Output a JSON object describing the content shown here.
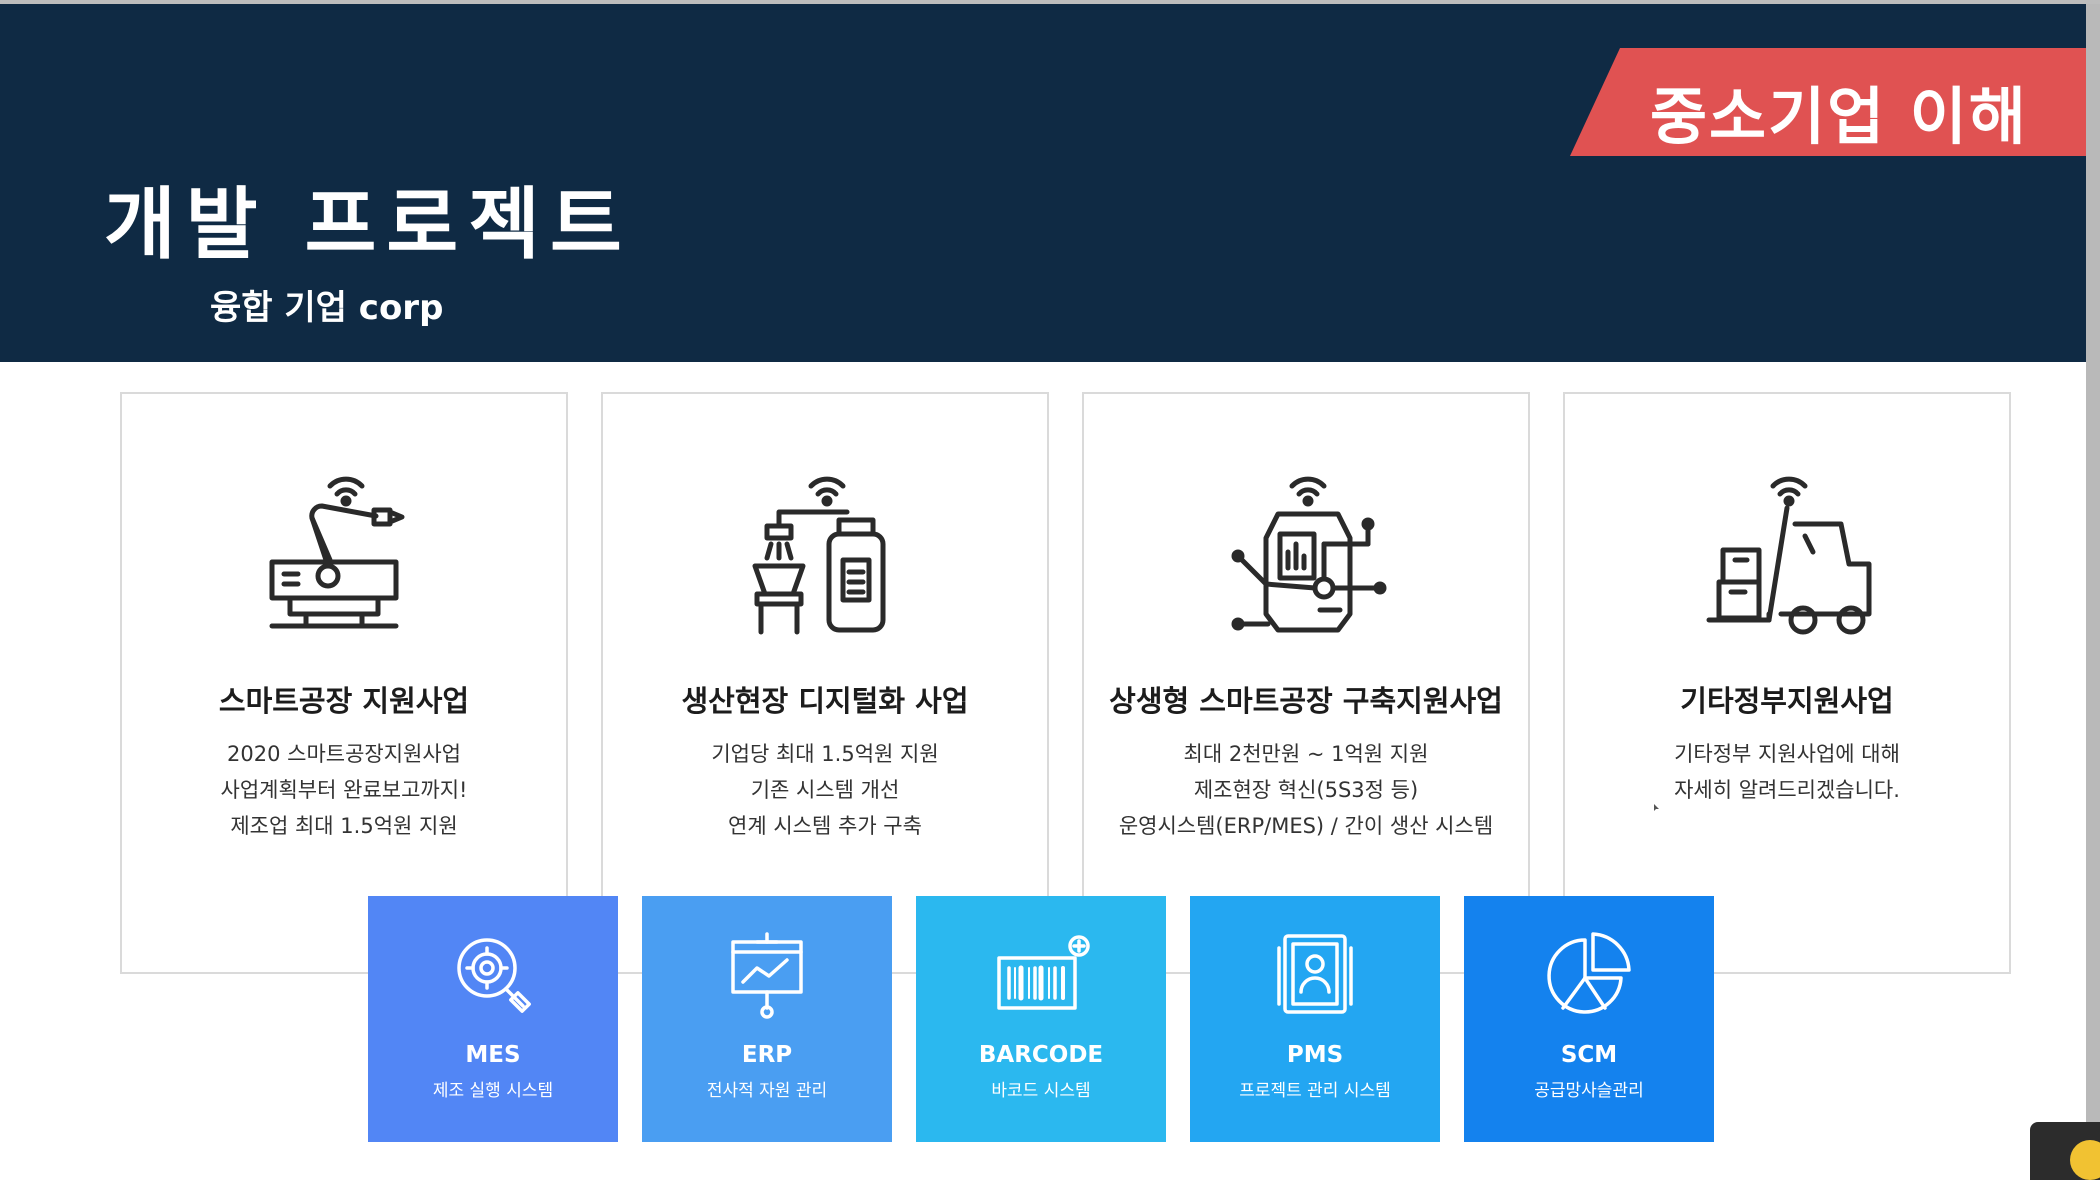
{
  "header": {
    "title": "개발 프로젝트",
    "subtitle": "융합 기업 corp",
    "ribbon": "중소기업 이해"
  },
  "cards": [
    {
      "icon": "robot-arm-icon",
      "title": "스마트공장 지원사업",
      "lines": [
        "2020 스마트공장지원사업",
        "사업계획부터 완료보고까지!",
        "제조업 최대 1.5억원 지원"
      ]
    },
    {
      "icon": "factory-machine-icon",
      "title": "생산현장 디지털화 사업",
      "lines": [
        "기업당 최대 1.5억원 지원",
        "기존 시스템 개선",
        "연계 시스템 추가 구축"
      ]
    },
    {
      "icon": "smart-chip-icon",
      "title": "상생형 스마트공장 구축지원사업",
      "lines": [
        "최대 2천만원 ~ 1억원 지원",
        "제조현장 혁신(5S3정 등)",
        "운영시스템(ERP/MES) / 간이 생산 시스템"
      ]
    },
    {
      "icon": "forklift-icon",
      "title": "기타정부지원사업",
      "lines": [
        "기타정부 지원사업에 대해",
        "자세히 알려드리겠습니다."
      ]
    }
  ],
  "tiles": [
    {
      "icon": "gear-search-icon",
      "label": "MES",
      "sub": "제조 실행 시스템",
      "color": "#5286f5"
    },
    {
      "icon": "chart-board-icon",
      "label": "ERP",
      "sub": "전사적 자원 관리",
      "color": "#4a9ef2"
    },
    {
      "icon": "barcode-icon",
      "label": "BARCODE",
      "sub": "바코드 시스템",
      "color": "#2bb8ef"
    },
    {
      "icon": "id-card-icon",
      "label": "PMS",
      "sub": "프로젝트 관리 시스템",
      "color": "#23a6f2"
    },
    {
      "icon": "pie-chart-icon",
      "label": "SCM",
      "sub": "공급망사슬관리",
      "color": "#1482ee"
    }
  ],
  "colors": {
    "header_bg": "#0f2a44",
    "ribbon_bg": "#e05252"
  }
}
